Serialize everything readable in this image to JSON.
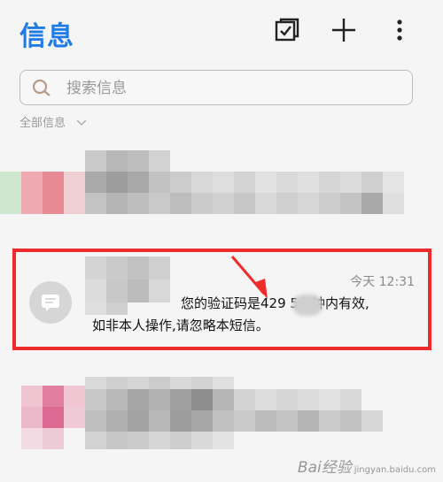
{
  "header": {
    "title": "信息",
    "icons": [
      "select-icon",
      "plus-icon",
      "more-vertical-icon"
    ]
  },
  "search": {
    "placeholder": "搜索信息"
  },
  "filter": {
    "label": "全部信息"
  },
  "message": {
    "time": "今天 12:31",
    "line1": "您的验证码是429     5分钟内有效,",
    "line2": "如非本人操作,请忽略本短信。"
  },
  "annotation": {
    "highlight_color": "#ef2b2b"
  },
  "watermark": {
    "text": "Bai经验",
    "sub": "jingyan.baidu.com"
  },
  "colors": {
    "accent": "#1f7be8",
    "background": "#f5f5f5"
  }
}
